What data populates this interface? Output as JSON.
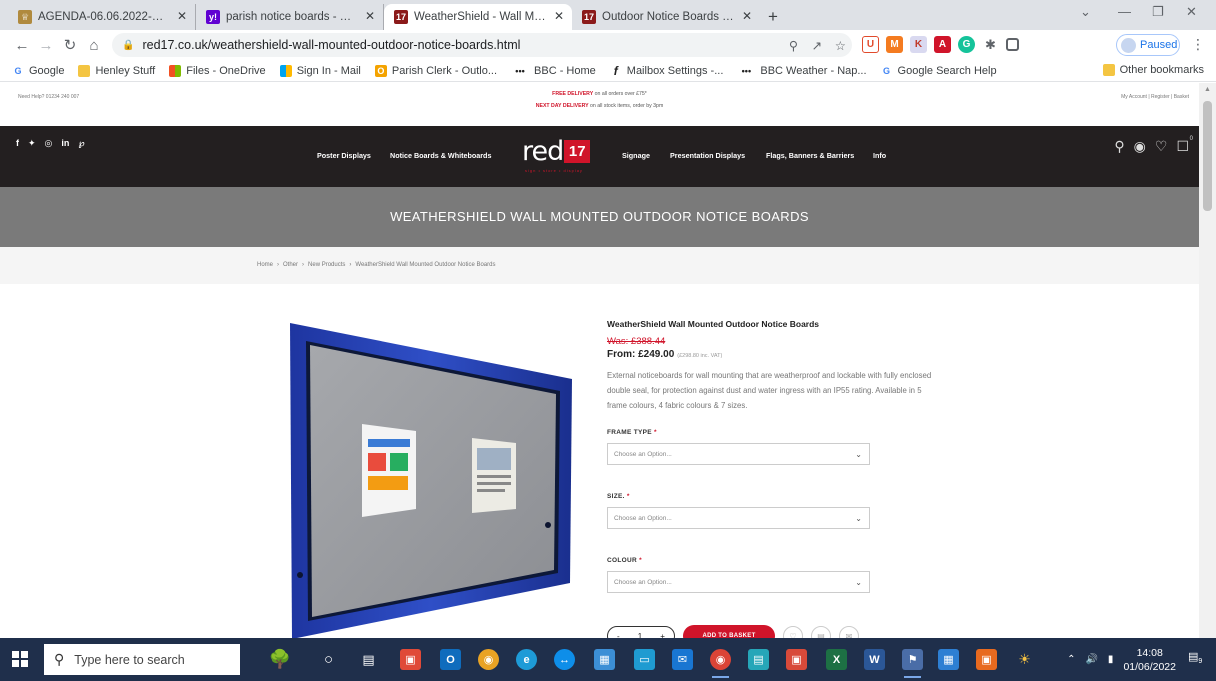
{
  "browser": {
    "tabs": [
      {
        "label": "AGENDA-06.06.2022-JPC-ORDIN",
        "icon": "crest-icon",
        "color": "#b08a3e",
        "active": false
      },
      {
        "label": "parish notice boards - Yahoo Sea",
        "icon": "yahoo-icon",
        "color": "#6001d2",
        "active": false
      },
      {
        "label": "WeatherShield - Wall Mounted O",
        "icon": "red17-icon",
        "color": "#8b1a1a",
        "active": true
      },
      {
        "label": "Outdoor Notice Boards | Lockabl",
        "icon": "red17-icon",
        "color": "#8b1a1a",
        "active": false
      }
    ],
    "new_tab": "+",
    "url": "red17.co.uk/weathershield-wall-mounted-outdoor-notice-boards.html",
    "profile_status": "Paused",
    "bookmarks": [
      {
        "label": "Google",
        "glyph": "G",
        "color": "#4285f4"
      },
      {
        "label": "Henley Stuff",
        "glyph": "",
        "color": "#f4c542"
      },
      {
        "label": "Files - OneDrive",
        "glyph": "",
        "color": "#f25022"
      },
      {
        "label": "Sign In - Mail",
        "glyph": "",
        "color": "#f25022"
      },
      {
        "label": "Parish Clerk - Outlo...",
        "glyph": "O",
        "color": "#f4a300"
      },
      {
        "label": "BBC - Home",
        "glyph": "•••",
        "color": "#222222"
      },
      {
        "label": "Mailbox Settings -...",
        "glyph": "f",
        "color": "#222222"
      },
      {
        "label": "BBC Weather - Nap...",
        "glyph": "•••",
        "color": "#222222"
      },
      {
        "label": "Google Search Help",
        "glyph": "G",
        "color": "#4285f4"
      }
    ],
    "other_bookmarks": "Other bookmarks"
  },
  "site": {
    "help": "Need Help? 01234 240 007",
    "promo1_bold": "FREE DELIVERY",
    "promo1_rest": " on all orders over £75*",
    "promo2_bold": "NEXT DAY DELIVERY",
    "promo2_rest": " on all stock items, order by 3pm",
    "account": "My Account | Register | Basket",
    "social": [
      "f",
      "✦",
      "◎",
      "in",
      "℘"
    ],
    "nav_left": [
      "Poster Displays",
      "Notice Boards & Whiteboards"
    ],
    "nav_right": [
      "Signage",
      "Presentation Displays",
      "Flags, Banners & Barriers",
      "Info"
    ],
    "logo_text": "red",
    "logo_num": "17",
    "logo_tag": "sign • store • display",
    "basket_count": "0",
    "banner_title": "WEATHERSHIELD WALL MOUNTED OUTDOOR NOTICE BOARDS",
    "breadcrumbs": [
      "Home",
      "Other",
      "New Products",
      "WeatherShield Wall Mounted Outdoor Notice Boards"
    ]
  },
  "product": {
    "title": "WeatherShield Wall Mounted Outdoor Notice Boards",
    "was": "Was: £388.44",
    "from": "From: £249.00",
    "from_inc": "(£298.80 inc. VAT)",
    "description": "External noticeboards for wall mounting that are weatherproof and lockable with fully enclosed double seal, for protection against dust and water ingress with an IP55 rating. Available in 5 frame colours, 4 fabric colours & 7 sizes.",
    "options": [
      {
        "label": "FRAME TYPE",
        "placeholder": "Choose an Option..."
      },
      {
        "label": "SIZE.",
        "placeholder": "Choose an Option..."
      },
      {
        "label": "COLOUR",
        "placeholder": "Choose an Option..."
      }
    ],
    "required_mark": "*",
    "qty_minus": "-",
    "qty_value": "1",
    "qty_plus": "+",
    "add_to_basket": "ADD TO BASKET",
    "frame_color": "#2740a8"
  },
  "taskbar": {
    "search_placeholder": "Type here to search",
    "time": "14:08",
    "date": "01/06/2022",
    "notification_count": "9"
  }
}
